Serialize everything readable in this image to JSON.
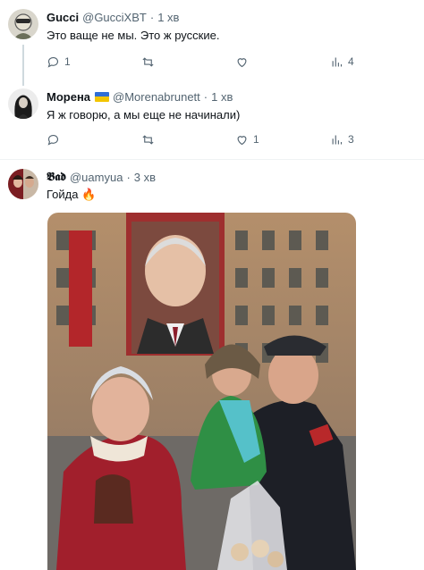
{
  "tweets": [
    {
      "name": "Gucci",
      "handle": "@GucciXBT",
      "time": "1 хв",
      "text": "Это ваще не мы. Это ж русские.",
      "actions": {
        "reply": "1",
        "retweet": "",
        "like": "",
        "views": "4"
      }
    },
    {
      "name": "Морена",
      "handle": "@Morenabrunett",
      "time": "1 хв",
      "text": "Я ж говорю, а мы еще не начинали)",
      "actions": {
        "reply": "",
        "retweet": "",
        "like": "1",
        "views": "3"
      }
    },
    {
      "name": "𝕭𝖆𝖉",
      "handle": "@uamyua",
      "time": "3 хв",
      "text": "Гойда 🔥"
    }
  ],
  "separator": "·",
  "colors": {
    "text": "#0f1419",
    "secondary": "#536471",
    "line": "#cfd9de",
    "divider": "#eff3f4",
    "flag_blue": "#2f6ed6",
    "flag_yellow": "#f2c500"
  },
  "icons": [
    "reply-icon",
    "retweet-icon",
    "like-icon",
    "views-icon",
    "ukraine-flag"
  ]
}
